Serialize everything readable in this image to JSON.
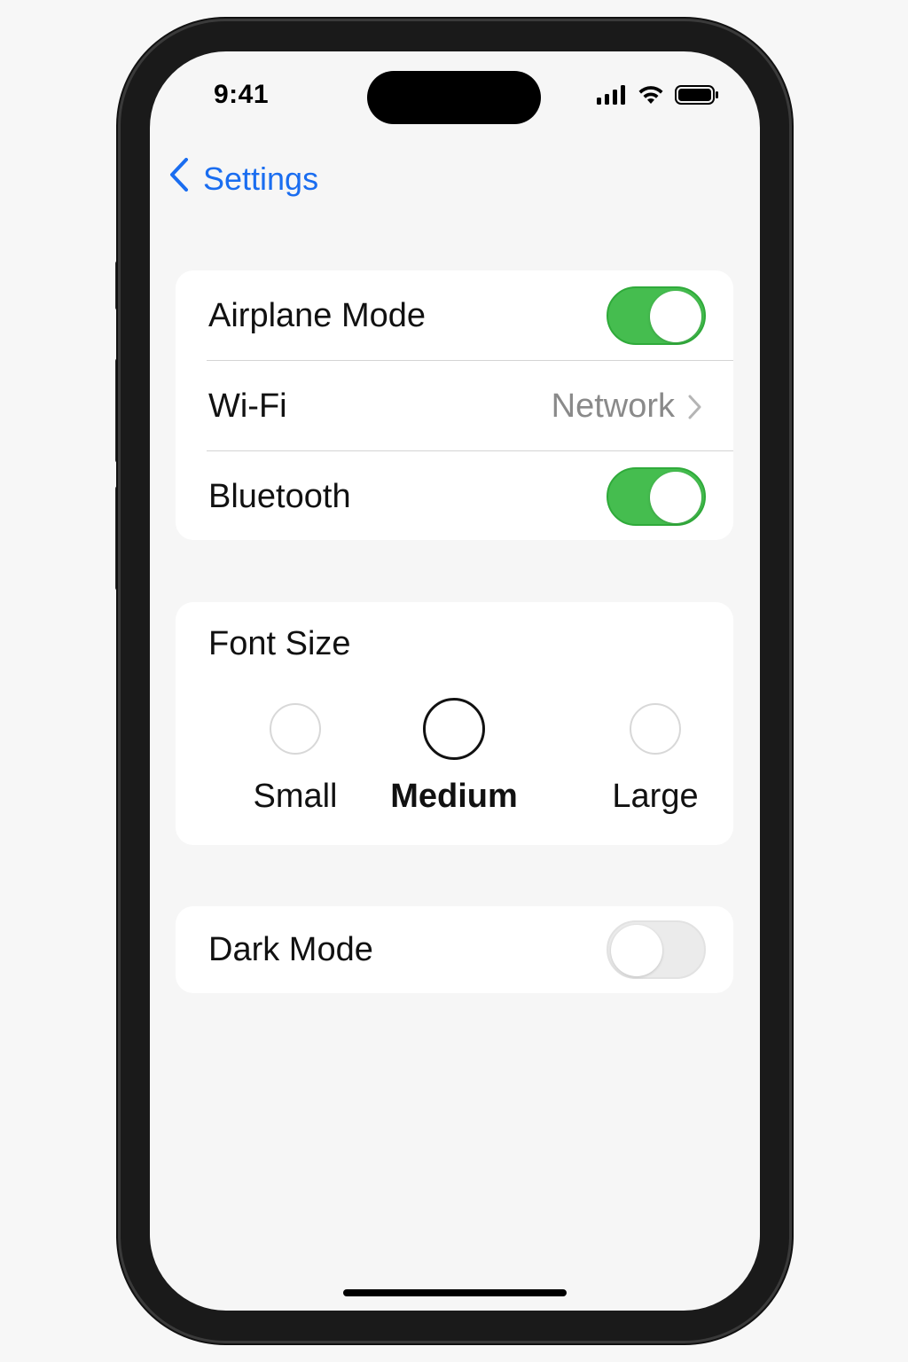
{
  "status_bar": {
    "time": "9:41",
    "icons": [
      "signal-icon",
      "wifi-icon",
      "battery-icon"
    ]
  },
  "nav": {
    "back_label": "Settings",
    "back_icon": "chevron-left-icon",
    "accent_color": "#1a6df0"
  },
  "connectivity": {
    "airplane": {
      "label": "Airplane Mode",
      "on": true
    },
    "wifi": {
      "label": "Wi-Fi",
      "value": "Network",
      "icon": "chevron-right-icon"
    },
    "bluetooth": {
      "label": "Bluetooth",
      "on": true
    }
  },
  "font_size": {
    "title": "Font Size",
    "options": [
      {
        "label": "Small",
        "selected": false
      },
      {
        "label": "Medium",
        "selected": true
      },
      {
        "label": "Large",
        "selected": false
      }
    ]
  },
  "appearance": {
    "dark_mode": {
      "label": "Dark Mode",
      "on": false
    }
  },
  "colors": {
    "toggle_on": "#45bd4f",
    "toggle_off": "#ebebeb",
    "secondary_text": "#8a8a8a"
  }
}
